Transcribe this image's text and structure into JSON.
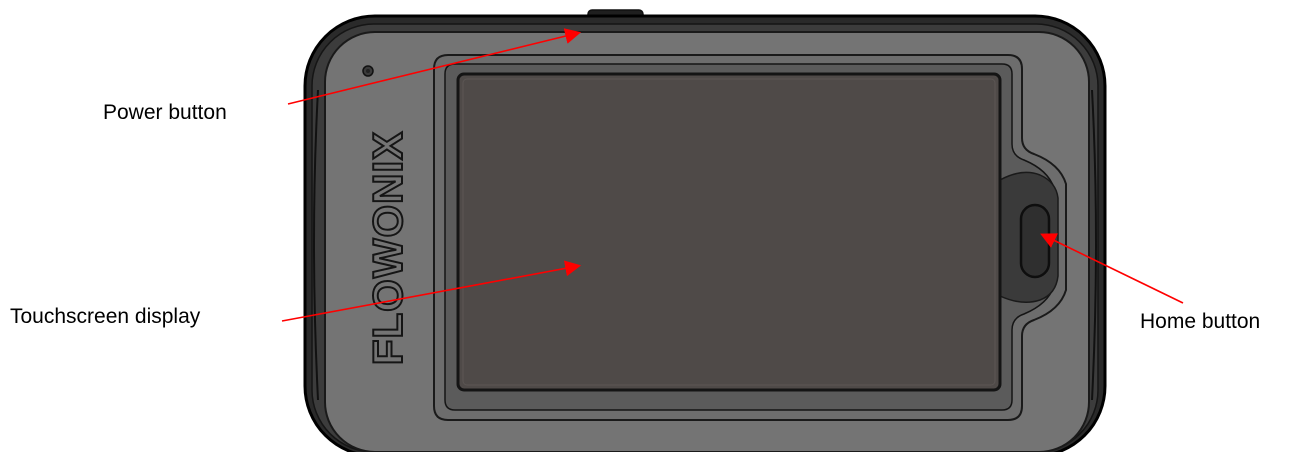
{
  "brand": {
    "logo_text": "FLOWONIX"
  },
  "callouts": {
    "power": "Power button",
    "touchscreen": "Touchscreen display",
    "home": "Home button"
  },
  "colors": {
    "body_outer": "#2b2b2b",
    "bezel": "#737373",
    "screen": "#4f4a48",
    "arrow": "#ff0000",
    "home_panel": "#3a3a3a"
  },
  "icons": {
    "power": "power-button",
    "home": "home-button"
  }
}
